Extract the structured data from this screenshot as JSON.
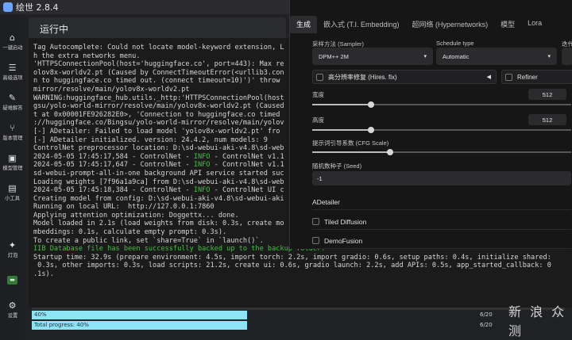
{
  "app": {
    "title": "绘世 2.8.4"
  },
  "sidebar": {
    "items": [
      {
        "label": "一键启动",
        "icon": "home-icon"
      },
      {
        "label": "高级选项",
        "icon": "list-icon"
      },
      {
        "label": "疑难解答",
        "icon": "wrench-icon"
      },
      {
        "label": "版本管理",
        "icon": "branch-icon"
      },
      {
        "label": "模型管理",
        "icon": "cube-icon"
      },
      {
        "label": "小工具",
        "icon": "toolbox-icon"
      },
      {
        "label": "灯泡",
        "icon": "bulb-icon"
      },
      {
        "label": "",
        "icon": "console-icon"
      },
      {
        "label": "设置",
        "icon": "gear-icon"
      }
    ]
  },
  "panel": {
    "header": "运行中"
  },
  "console_lines": [
    "Tag Autocomplete: Could not locate model-keyword extension, L",
    "h the extra networks menu.",
    "'HTTPSConnectionPool(host='huggingface.co', port=443): Max re",
    "olov8x-worldv2.pt (Caused by ConnectTimeoutError(<urllib3.con",
    "n to huggingface.co timed out. (connect timeout=10)')' throw",
    "mirror/resolve/main/yolov8x-worldv2.pt",
    "WARNING:huggingface_hub.utils._http:'HTTPSConnectionPool(host",
    "gsu/yolo-world-mirror/resolve/main/yolov8x-worldv2.pt (Caused",
    "t at 0x00001FE926282E0>, 'Connection to huggingface.co timed",
    "://huggingface.co/Bingsu/yolo-world-mirror/resolve/main/yolov",
    "[-] ADetailer: Failed to load model 'yolov8x-worldv2.pt' fro",
    "[-] ADetailer initialized. version: 24.4.2, num models: 9",
    "ControlNet preprocessor location: D:\\sd-webui-aki-v4.8\\sd-web",
    "2024-05-05 17:45:17,584 - ControlNet - INFO - ControlNet v1.1",
    "2024-05-05 17:45:17,647 - ControlNet - INFO - ControlNet v1.1",
    "sd-webui-prompt-all-in-one background API service started suc",
    "Loading weights [7f96a1a9ca] from D:\\sd-webui-aki-v4.8\\sd-web",
    "2024-05-05 17:45:18,384 - ControlNet - INFO - ControlNet UI c",
    "Creating model from config: D:\\sd-webui-aki-v4.8\\sd-webui-aki",
    "Running on local URL:  http://127.0.0.1:7860",
    "Applying attention optimization: Doggettx... done.",
    "Model loaded in 2.1s (load weights from disk: 0.3s, create mo",
    "mbeddings: 0.1s, calculate empty prompt: 0.3s).",
    "",
    "To create a public link, set `share=True` in `launch()`.",
    "IIB Database file has been successfully backed up to the backup folder.",
    "Startup time: 32.9s (prepare environment: 4.5s, import torch: 2.2s, import gradio: 0.6s, setup paths: 0.4s, initialize shared:",
    " 0.3s, other imports: 0.3s, load scripts: 21.2s, create ui: 0.6s, gradio launch: 2.2s, add APIs: 0.5s, app_started_callback: 0",
    ".1s)."
  ],
  "overlay": {
    "tabs": [
      "生成",
      "嵌入式 (T.I. Embedding)",
      "超网络 (Hypernetworks)",
      "模型",
      "Lora"
    ],
    "sampler_label": "采样方法 (Sampler)",
    "sampler_value": "DPM++ 2M",
    "schedule_label": "Schedule type",
    "schedule_value": "Automatic",
    "extra_label": "迭代",
    "hires_label": "高分辨率修复 (Hires. fix)",
    "refiner_label": "Refiner",
    "width_label": "宽度",
    "width_value": "512",
    "height_label": "高度",
    "height_value": "512",
    "cfg_label": "提示词引导系数 (CFG Scale)",
    "seed_label": "随机数种子 (Seed)",
    "seed_value": "-1",
    "accordions": [
      "ADetailer",
      "Tiled Diffusion",
      "DemoFusion"
    ]
  },
  "progress": {
    "bar1": "40%",
    "bar2": "Total progress: 40%",
    "stat1": "6/20",
    "stat2": "6/20"
  },
  "watermark": "新 浪 众 测"
}
